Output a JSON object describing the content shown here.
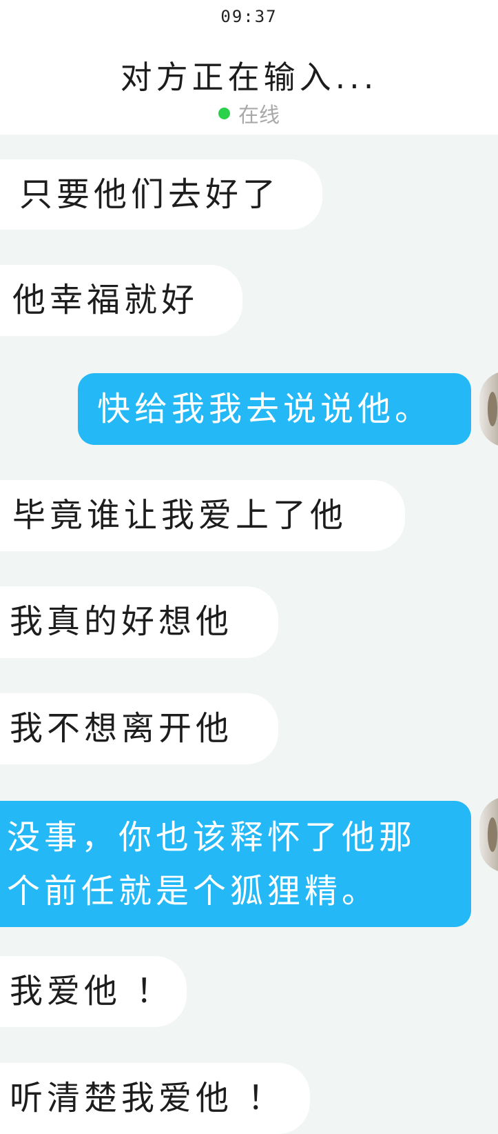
{
  "status_bar": {
    "time": "09:37"
  },
  "header": {
    "title": "对方正在输入...",
    "status": "在线",
    "status_color": "#2bd14a"
  },
  "colors": {
    "incoming_bubble": "#ffffff",
    "outgoing_bubble": "#24b8f6",
    "chat_background": "#f1f5f4"
  },
  "messages": [
    {
      "direction": "incoming",
      "text": "只要他们去好了"
    },
    {
      "direction": "incoming",
      "text": "他幸福就好"
    },
    {
      "direction": "outgoing",
      "text": "快给我我去说说他。"
    },
    {
      "direction": "incoming",
      "text": "毕竟谁让我爱上了他"
    },
    {
      "direction": "incoming",
      "text": "我真的好想他"
    },
    {
      "direction": "incoming",
      "text": "我不想离开他"
    },
    {
      "direction": "outgoing",
      "lines": [
        "没事，你也该释怀了他那",
        "个前任就是个狐狸精。"
      ]
    },
    {
      "direction": "incoming",
      "text": "我爱他 ！"
    },
    {
      "direction": "incoming",
      "text": "听清楚我爱他 ！"
    }
  ]
}
